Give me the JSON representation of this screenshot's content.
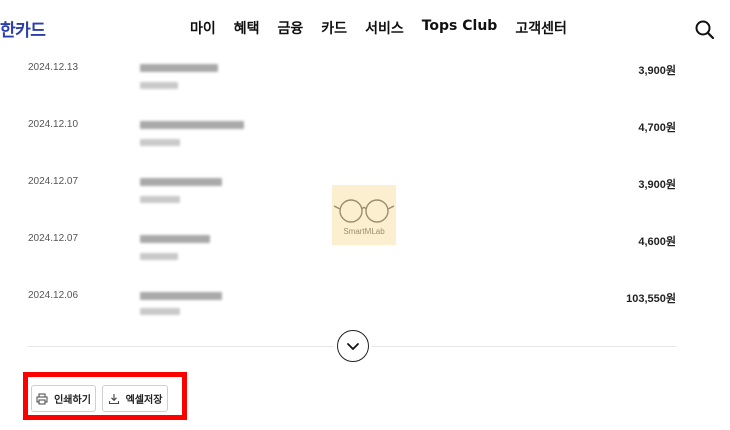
{
  "header": {
    "logo": "한카드",
    "nav": [
      "마이",
      "혜택",
      "금융",
      "카드",
      "서비스",
      "Tops Club",
      "고객센터"
    ],
    "search_icon": "search-icon"
  },
  "transactions": [
    {
      "date": "2024.12.13",
      "amount": "3,900원"
    },
    {
      "date": "2024.12.10",
      "amount": "4,700원"
    },
    {
      "date": "2024.12.07",
      "amount": "3,900원"
    },
    {
      "date": "2024.12.07",
      "amount": "4,600원"
    },
    {
      "date": "2024.12.06",
      "amount": "103,550원"
    }
  ],
  "watermark": {
    "text": "SmartMLab",
    "icon": "glasses-icon"
  },
  "more": {
    "icon": "chevron-down-icon"
  },
  "actions": {
    "print_label": "인쇄하기",
    "print_icon": "printer-icon",
    "excel_label": "엑셀저장",
    "excel_icon": "download-icon"
  },
  "colors": {
    "brand": "#2c3fa8",
    "highlight": "#ff0000"
  }
}
